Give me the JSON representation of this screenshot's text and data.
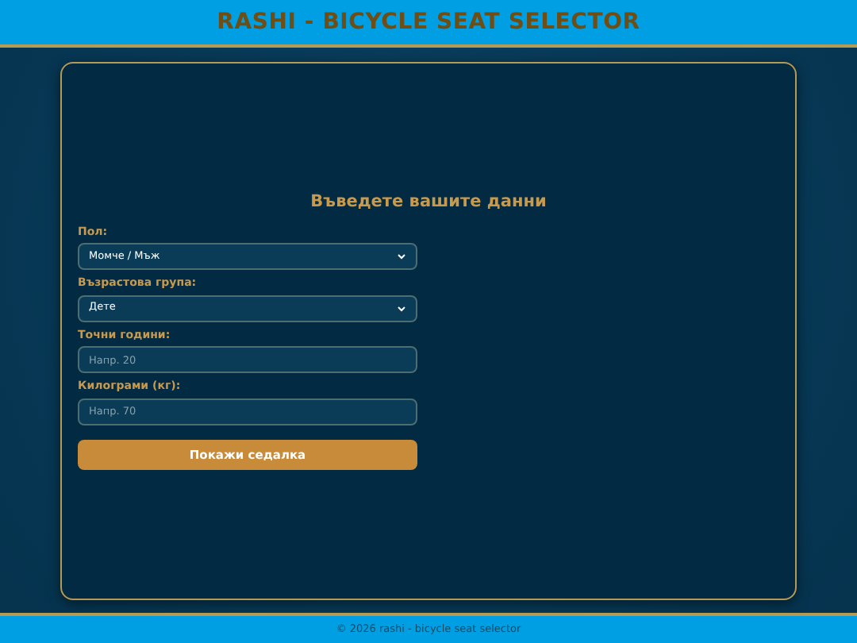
{
  "header": {
    "title": "RASHI - BICYCLE SEAT SELECTOR"
  },
  "form": {
    "title": "Въведете вашите данни",
    "fields": [
      {
        "kind": "select",
        "label": "Пол:",
        "value": "Момче / Мъж"
      },
      {
        "kind": "select",
        "label": "Възрастова група:",
        "value": "Дете"
      },
      {
        "kind": "input",
        "label": "Точни години:",
        "placeholder": "Напр. 20"
      },
      {
        "kind": "input",
        "label": "Килограми (кг):",
        "placeholder": "Напр. 70"
      }
    ],
    "button": "Покажи седалка"
  },
  "footer": {
    "text": "© 2026 rashi - bicycle seat selector"
  }
}
